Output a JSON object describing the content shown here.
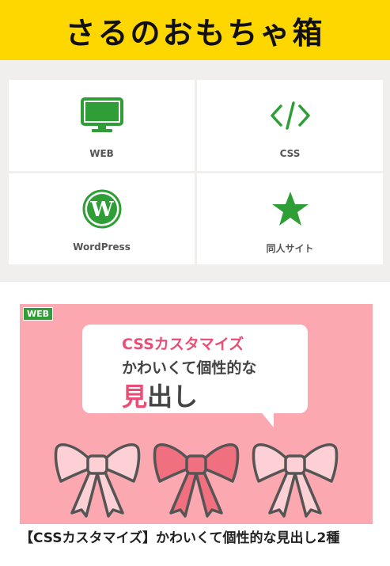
{
  "header": {
    "site_title": "さるのおもちゃ箱"
  },
  "categories": [
    {
      "label": "WEB",
      "icon": "monitor-icon"
    },
    {
      "label": "CSS",
      "icon": "code-icon"
    },
    {
      "label": "WordPress",
      "icon": "wordpress-icon"
    },
    {
      "label": "同人サイト",
      "icon": "star-icon"
    }
  ],
  "article": {
    "badge": "WEB",
    "thumb_line1": "CSSカスタマイズ",
    "thumb_line2": "かわいくて個性的な",
    "thumb_line3_accent": "見",
    "thumb_line3_rest": "出し",
    "title": "【CSSカスタマイズ】かわいくて個性的な見出し2種"
  },
  "colors": {
    "header_bg": "#ffd700",
    "icon_green": "#2f9e37",
    "thumb_bg": "#fba8b0",
    "accent_pink": "#e94e77"
  }
}
